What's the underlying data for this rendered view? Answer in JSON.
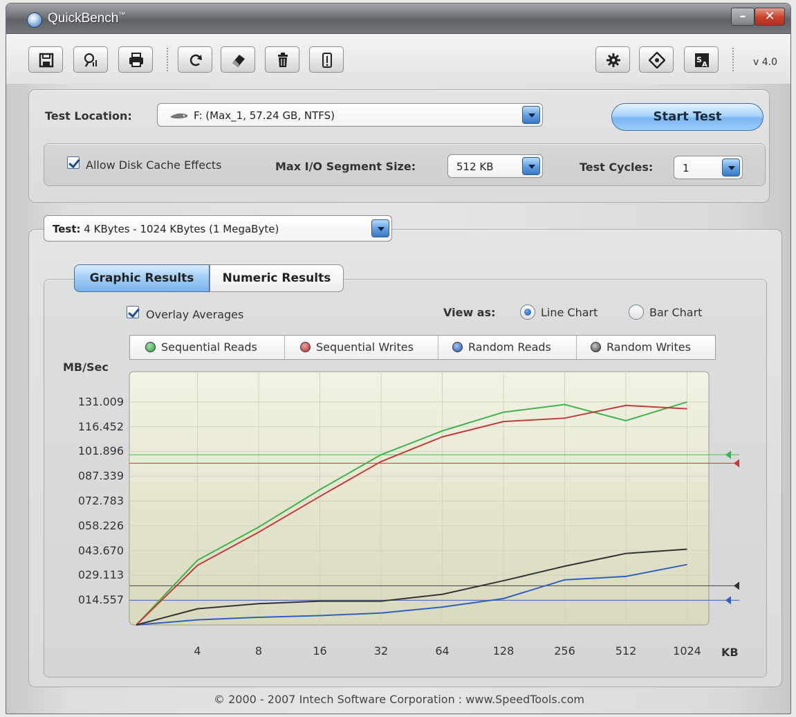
{
  "window": {
    "title": "QuickBench",
    "title_mark": "™",
    "version": "v 4.0"
  },
  "toolbar": {
    "icons": [
      "save-icon",
      "report-icon",
      "print-icon",
      "refresh-icon",
      "erase-icon",
      "trash-icon",
      "info-icon",
      "settings-icon",
      "register-icon",
      "language-icon"
    ]
  },
  "location": {
    "label": "Test Location:",
    "value": "F:  (Max_1, 57.24 GB, NTFS)"
  },
  "start_button": "Start Test",
  "options": {
    "cache_label": "Allow Disk Cache Effects",
    "cache_checked": true,
    "segment_label": "Max I/O Segment Size:",
    "segment_value": "512 KB",
    "cycles_label": "Test Cycles:",
    "cycles_value": "1"
  },
  "test": {
    "label": "Test:",
    "value": "4 KBytes - 1024 KBytes  (1 MegaByte)"
  },
  "tabs": {
    "graphic": "Graphic Results",
    "numeric": "Numeric Results"
  },
  "view": {
    "overlay_label": "Overlay Averages",
    "view_as_label": "View as:",
    "line_label": "Line Chart",
    "bar_label": "Bar Chart",
    "selected": "line"
  },
  "chart_data": {
    "type": "line",
    "ylabel": "MB/Sec",
    "xunit": "KB",
    "ylim": [
      0,
      145.566
    ],
    "y_ticks": [
      "014.557",
      "029.113",
      "043.670",
      "058.226",
      "072.783",
      "087.339",
      "101.896",
      "116.452",
      "131.009"
    ],
    "categories": [
      "4",
      "8",
      "16",
      "32",
      "64",
      "128",
      "256",
      "512",
      "1024"
    ],
    "grid": true,
    "colors": {
      "Sequential Reads": "#3fb34f",
      "Sequential Writes": "#c23a3a",
      "Random Reads": "#2f5fbf",
      "Random Writes": "#333333"
    },
    "series": [
      {
        "name": "Sequential Reads",
        "start": 0,
        "values": [
          38.0,
          57.5,
          79.5,
          100.0,
          114.0,
          125.0,
          129.5,
          120.0,
          131.0
        ]
      },
      {
        "name": "Sequential Writes",
        "start": 0,
        "values": [
          35.0,
          54.5,
          75.5,
          96.0,
          110.5,
          119.5,
          121.5,
          129.0,
          127.0
        ]
      },
      {
        "name": "Random Reads",
        "start": 0,
        "values": [
          3.0,
          4.5,
          5.5,
          7.0,
          10.5,
          15.5,
          26.5,
          28.5,
          35.5
        ]
      },
      {
        "name": "Random Writes",
        "start": 0,
        "values": [
          9.5,
          12.5,
          14.0,
          14.0,
          18.0,
          26.0,
          34.5,
          42.0,
          44.5
        ]
      }
    ],
    "averages": [
      {
        "name": "Sequential Reads",
        "value": 100.0
      },
      {
        "name": "Sequential Writes",
        "value": 95.0
      },
      {
        "name": "Random Reads",
        "value": 14.5
      },
      {
        "name": "Random Writes",
        "value": 23.0
      }
    ]
  },
  "footer": "© 2000 - 2007  Intech Software Corporation   :   www.SpeedTools.com"
}
